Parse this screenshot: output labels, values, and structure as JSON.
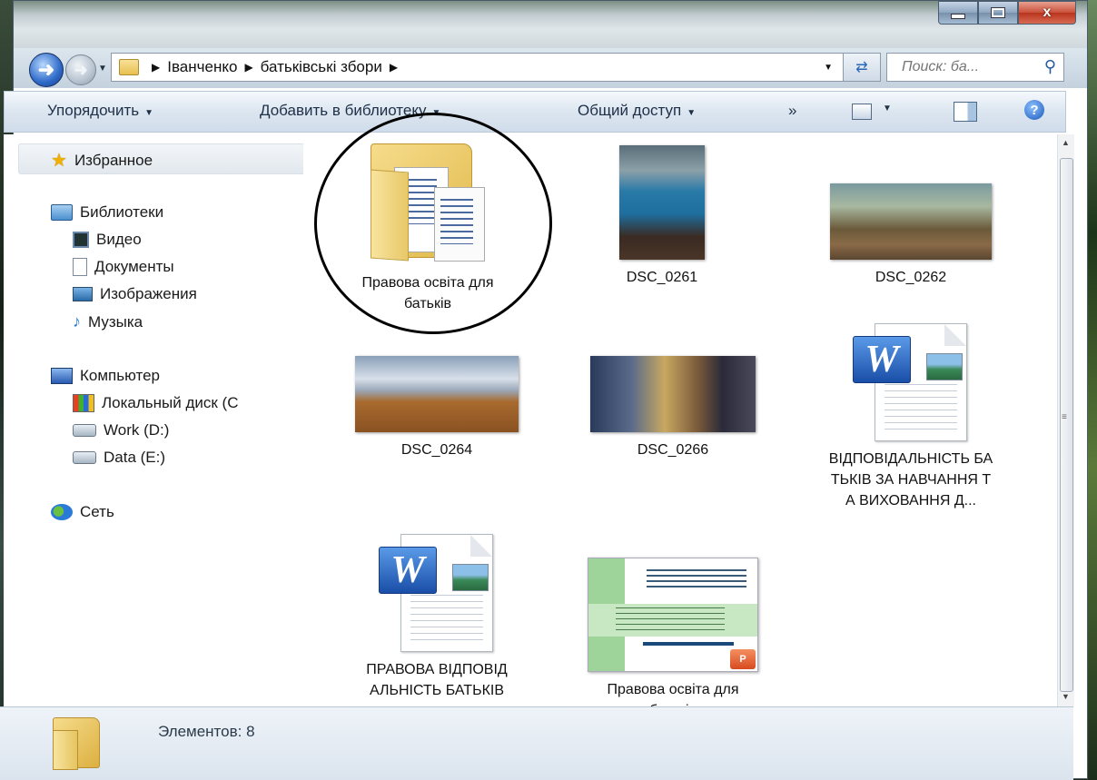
{
  "window": {
    "controls": {
      "minimize": "minimize",
      "maximize": "maximize",
      "close": "x"
    }
  },
  "address": {
    "path": [
      "Іванченко",
      "батьківські збори"
    ],
    "search_placeholder": "Поиск: ба..."
  },
  "toolbar": {
    "organize": "Упорядочить",
    "add_to_library": "Добавить в библиотеку",
    "share": "Общий доступ",
    "more": "»"
  },
  "nav": {
    "favorites": "Избранное",
    "libraries": "Библиотеки",
    "video": "Видео",
    "documents": "Документы",
    "images": "Изображения",
    "music": "Музыка",
    "computer": "Компьютер",
    "local_disk": "Локальный диск (C",
    "work": "Work (D:)",
    "data": "Data (E:)",
    "network": "Сеть"
  },
  "items": [
    {
      "name": "Правова освіта для батьків",
      "type": "folder"
    },
    {
      "name": "DSC_0261",
      "type": "photo"
    },
    {
      "name": "DSC_0262",
      "type": "photo"
    },
    {
      "name": "DSC_0264",
      "type": "photo"
    },
    {
      "name": "DSC_0266",
      "type": "photo"
    },
    {
      "name": "ВІДПОВІДАЛЬНІСТЬ БАТЬКІВ ЗА НАВЧАННЯ ТА ВИХОВАННЯ Д...",
      "type": "word"
    },
    {
      "name": "ПРАВОВА ВІДПОВІДАЛЬНІСТЬ БАТЬКІВ",
      "type": "word"
    },
    {
      "name": "Правова освіта для батьків",
      "type": "powerpoint"
    }
  ],
  "status": {
    "count_text": "Элементов: 8"
  },
  "colors": {
    "accent": "#2e6ac8",
    "folder": "#f0d070"
  }
}
